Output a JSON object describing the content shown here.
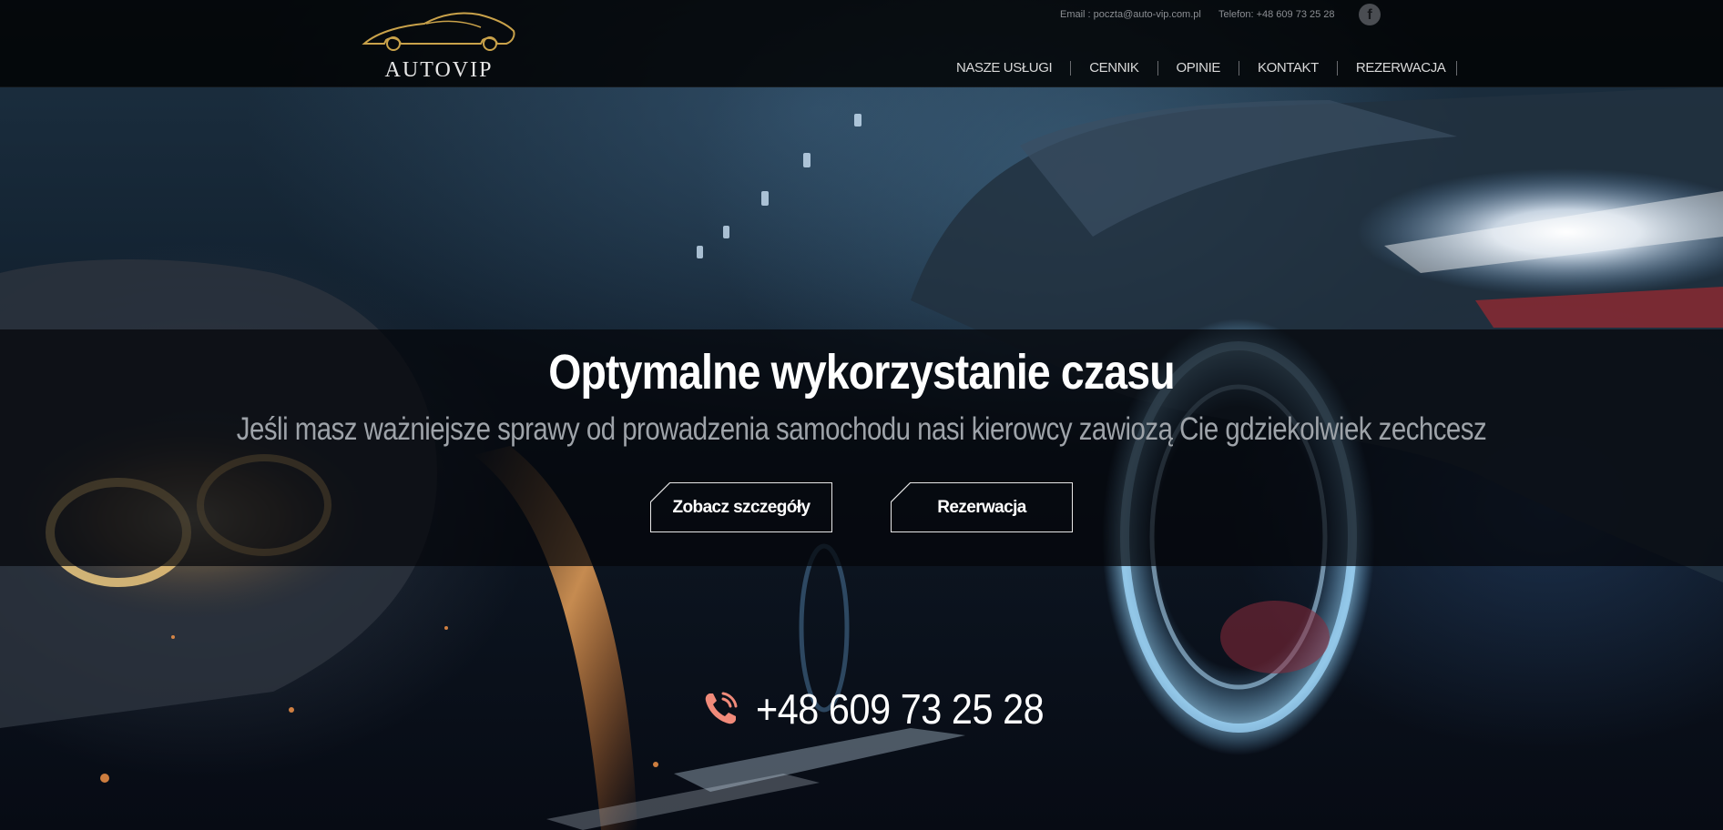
{
  "header": {
    "logo_text": "AUTOVIP",
    "contact_email": "Email : poczta@auto-vip.com.pl",
    "contact_phone": "Telefon: +48 609 73 25 28",
    "social_icon": "facebook-icon",
    "nav": [
      {
        "label": "NASZE USŁUGI"
      },
      {
        "label": "CENNIK"
      },
      {
        "label": "OPINIE"
      },
      {
        "label": "KONTAKT"
      },
      {
        "label": "REZERWACJA"
      }
    ]
  },
  "hero": {
    "headline": "Optymalne wykorzystanie czasu",
    "subheadline": "Jeśli masz ważniejsze sprawy od prowadzenia samochodu nasi kierowcy zawiozą Cie gdziekolwiek zechcesz",
    "buttons": {
      "details_label": "Zobacz szczegóły",
      "booking_label": "Rezerwacja"
    },
    "phone_icon": "phone-ringing-icon",
    "phone_number": "+48 609 73 25 28"
  },
  "colors": {
    "header_bg": "#000000",
    "accent_gold": "#c9a24a",
    "phone_icon": "#f08a7a",
    "subtext": "#9ea3a9"
  }
}
